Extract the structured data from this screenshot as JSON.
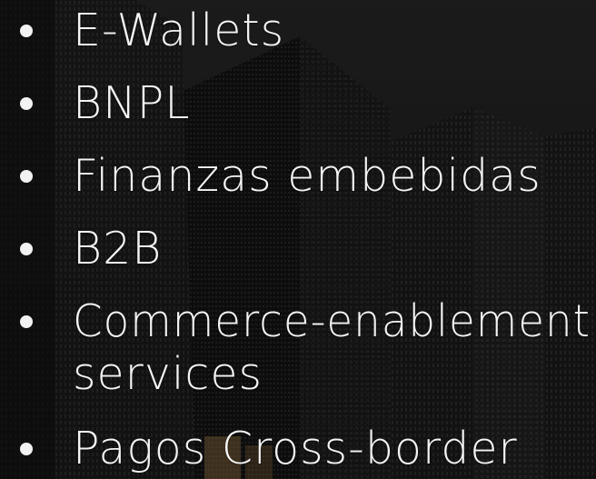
{
  "list": {
    "items": [
      {
        "label": "E-Wallets"
      },
      {
        "label": "BNPL"
      },
      {
        "label": "Finanzas embebidas"
      },
      {
        "label": "B2B"
      },
      {
        "label": "Commerce-enablement",
        "label_line2": "services"
      },
      {
        "label": "Pagos Cross-border"
      }
    ]
  },
  "colors": {
    "text": "#f4f4f4",
    "background": "#161616",
    "building_light": "#3a3a3a",
    "building_dark": "#0c0c0c"
  },
  "icons": {
    "bullet": "bullet-dot-icon",
    "background": "skyscrapers-photo"
  }
}
